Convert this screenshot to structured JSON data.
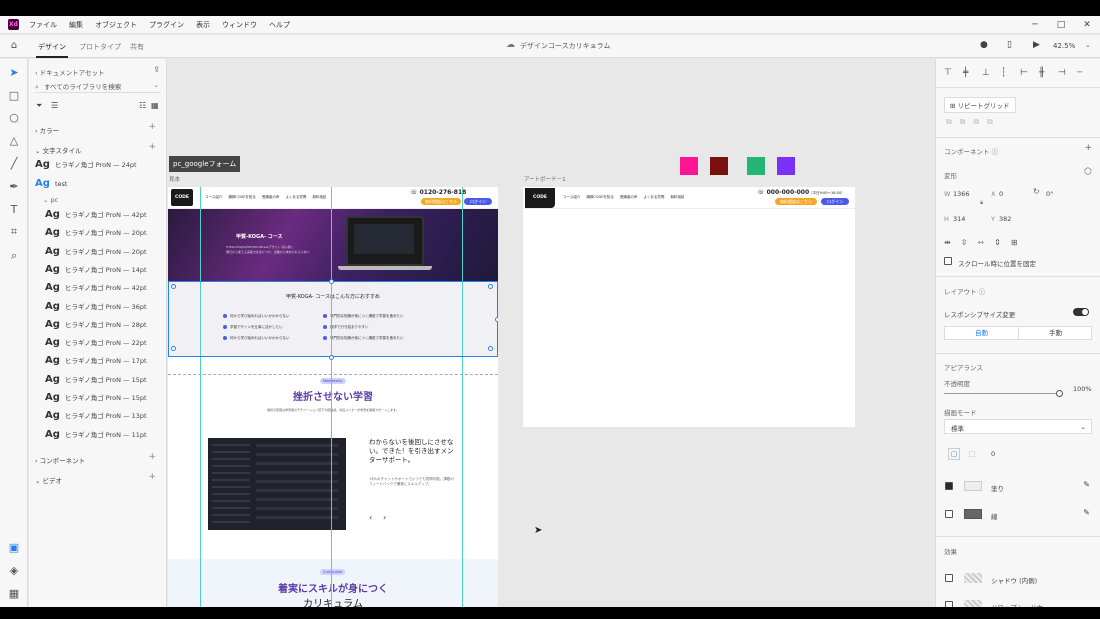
{
  "menu": {
    "items": [
      "ファイル",
      "編集",
      "オブジェクト",
      "プラグイン",
      "表示",
      "ウィンドウ",
      "ヘルプ"
    ]
  },
  "tabs": {
    "design": "デザイン",
    "prototype": "プロトタイプ",
    "share": "共有"
  },
  "doc_title": "デザインコースカリキュラム",
  "zoom": "42.5%",
  "assets": {
    "breadcrumb": "ドキュメントアセット",
    "search_placeholder": "すべてのライブラリを検索",
    "colors": "カラー",
    "char_styles": "文字スタイル",
    "style_primary": "ヒラギノ角ゴ ProN — 24pt",
    "style_test": "test",
    "folder": "pc",
    "styles": [
      "ヒラギノ角ゴ ProN — 42pt",
      "ヒラギノ角ゴ ProN — 20pt",
      "ヒラギノ角ゴ ProN — 20pt",
      "ヒラギノ角ゴ ProN — 14pt",
      "ヒラギノ角ゴ ProN — 42pt",
      "ヒラギノ角ゴ ProN — 36pt",
      "ヒラギノ角ゴ ProN — 28pt",
      "ヒラギノ角ゴ ProN — 22pt",
      "ヒラギノ角ゴ ProN — 17pt",
      "ヒラギノ角ゴ ProN — 15pt",
      "ヒラギノ角ゴ ProN — 15pt",
      "ヒラギノ角ゴ ProN — 13pt",
      "ヒラギノ角ゴ ProN — 11pt"
    ],
    "components": "コンポーネント",
    "video": "ビデオ"
  },
  "canvas": {
    "tooltip": "pc_googleフォーム",
    "artboard1_label": "見本",
    "artboard2_label": "アートボード－1",
    "swatches": [
      "#ff1493",
      "#7a1010",
      "#22b573",
      "#7b2ff7"
    ],
    "ab1": {
      "logo": "CODE",
      "nav": [
        "コース紹介",
        "講師CODEを知る",
        "受講者の声",
        "よくある質問",
        "無料相談"
      ],
      "phone": "0120-276-818",
      "btn_orange": "無料相談はこちら",
      "btn_blue": "ログイン",
      "hero_title": "甲賀-KOGA- コース",
      "hero_sub1": "HTML/CSS/JS/PHP/WordPressデザイン 初心者に",
      "hero_sub2": "明日から使える実践力を身につけ、企業から求められる人材へ",
      "recommend_title": "甲賀-KOGA- コースはこんな方におすすめ",
      "recommend_items": [
        "何から学び始めればいいかわからない",
        "学習デザインを仕事に活かしたい",
        "何から学び始めればいいかわからない",
        "専門的な知識が身につく講座で学習を進めたい",
        "独学で行き詰まりやすい",
        "専門的な知識が身につく講座で学習を進めたい"
      ],
      "mentorship_tag": "Mentorship",
      "mentor_title": "挫折させない学習",
      "mentor_desc": "挫折の原因は学習者のモチベーション低下や孤独感。専任メンターが学習を徹底サポートします。",
      "mentor_heading": "わからないを後回しにさせない。できた！を引き出すメンターサポート。",
      "mentor_body": "1対1のチャットサポートでいつでも質問可能。課題のフィードバックで確実にスキルアップ。",
      "nav_prev": "‹",
      "nav_next": "›",
      "curriculum_tag": "Curriculum",
      "curriculum_title1": "着実にスキルが身につく",
      "curriculum_title2": "カリキュラム"
    },
    "ab2": {
      "logo": "CODE",
      "nav": [
        "コース紹介",
        "講師CODEを知る",
        "受講者の声",
        "よくある質問",
        "無料相談"
      ],
      "phone": "000-000-000",
      "hours": "（平日9:00～18:00）",
      "btn_orange": "無料相談はこちら",
      "btn_blue": "ログイン"
    }
  },
  "props": {
    "repeat_grid": "リピートグリッド",
    "component": "コンポーネント",
    "transform": "変形",
    "w_label": "W",
    "w": "1366",
    "x_label": "X",
    "x": "0",
    "rot": "0°",
    "h_label": "H",
    "h": "314",
    "y_label": "Y",
    "y": "382",
    "fix_scroll": "スクロール時に位置を固定",
    "layout": "レイアウト",
    "responsive": "レスポンシブサイズ変更",
    "auto": "自動",
    "manual": "手動",
    "appearance": "アピアランス",
    "opacity_label": "不透明度",
    "opacity": "100%",
    "blend_label": "描画モード",
    "blend": "標準",
    "corner": "0",
    "fill": "塗り",
    "border": "線",
    "effects": "効果",
    "inner_shadow": "シャドウ (内側)",
    "drop_shadow": "ドロップシャドウ"
  }
}
